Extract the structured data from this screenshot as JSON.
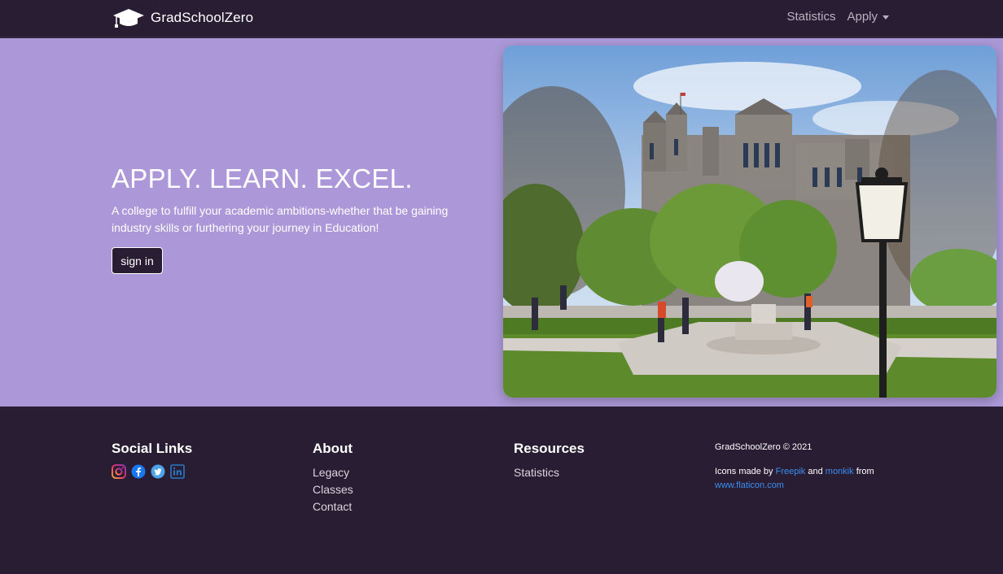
{
  "navbar": {
    "brand": "GradSchoolZero",
    "links": [
      "Statistics",
      "Apply"
    ]
  },
  "hero": {
    "title": "APPLY. LEARN. EXCEL.",
    "subtitle": "A college to fulfill your academic ambitions-whether that be gaining industry skills or furthering your journey in Education!",
    "signin_label": "sign in",
    "image_alt": "campus-photo"
  },
  "footer": {
    "social_heading": "Social Links",
    "social_icons": [
      "instagram-icon",
      "facebook-icon",
      "twitter-icon",
      "linkedin-icon"
    ],
    "about_heading": "About",
    "about_links": [
      "Legacy",
      "Classes",
      "Contact"
    ],
    "resources_heading": "Resources",
    "resources_links": [
      "Statistics"
    ],
    "copyright": "GradSchoolZero © 2021",
    "credit_prefix": "Icons made by",
    "credit_freepik": "Freepik",
    "credit_and": "and",
    "credit_monkik": "monkik",
    "credit_from": "from",
    "credit_site": "www.flaticon.com"
  },
  "colors": {
    "dark": "#291d33",
    "hero_bg": "#ac98d8",
    "link_blue": "#3a8ff0"
  }
}
